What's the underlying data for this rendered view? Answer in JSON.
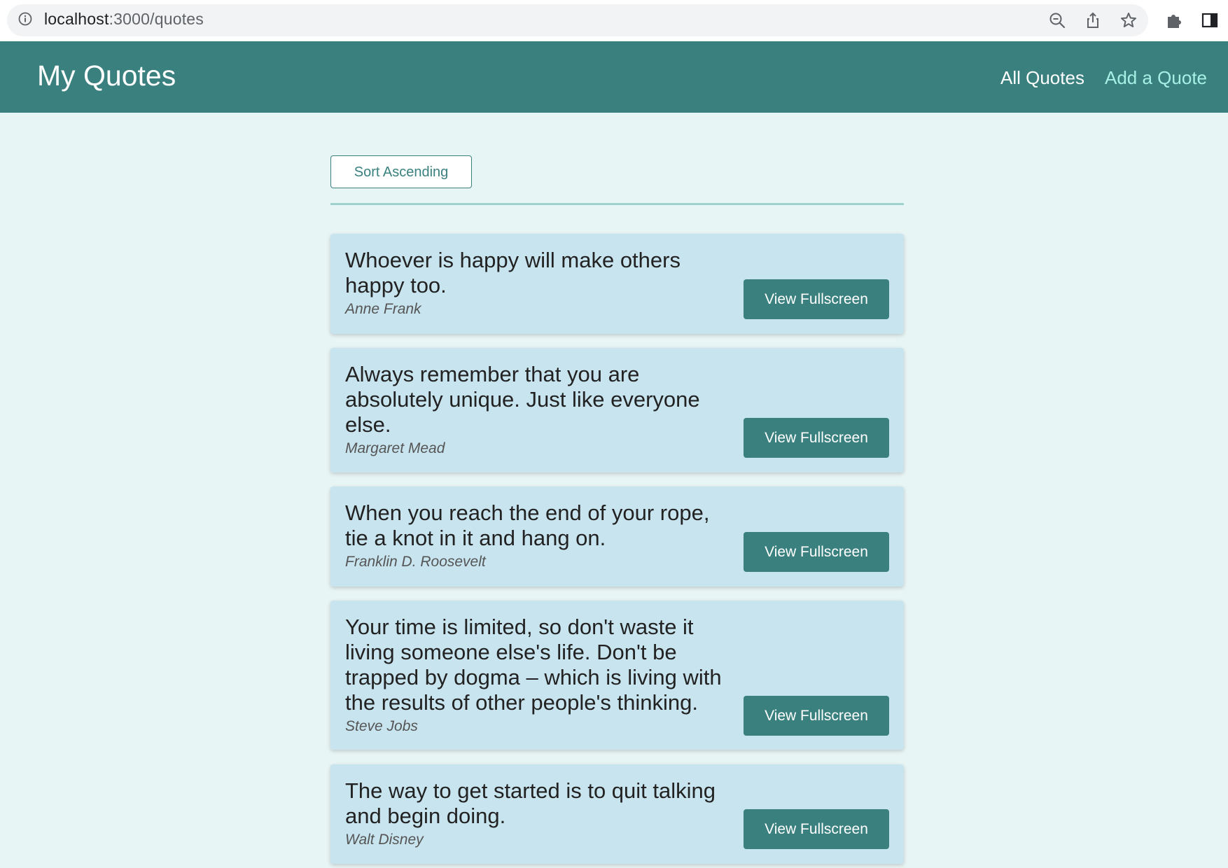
{
  "browser": {
    "url_host": "localhost",
    "url_path": ":3000/quotes",
    "icons": [
      "info-icon",
      "zoom-out-icon",
      "share-icon",
      "bookmark-star-icon",
      "extensions-puzzle-icon",
      "side-panel-icon"
    ]
  },
  "header": {
    "brand": "My Quotes",
    "nav": {
      "all_quotes": "All Quotes",
      "add_quote": "Add a Quote"
    }
  },
  "toolbar": {
    "sort_label": "Sort Ascending"
  },
  "quotes": [
    {
      "text": "Whoever is happy will make others happy too.",
      "author": "Anne Frank",
      "button": "View Fullscreen"
    },
    {
      "text": "Always remember that you are absolutely unique. Just like everyone else.",
      "author": "Margaret Mead",
      "button": "View Fullscreen"
    },
    {
      "text": "When you reach the end of your rope, tie a knot in it and hang on.",
      "author": "Franklin D. Roosevelt",
      "button": "View Fullscreen"
    },
    {
      "text": "Your time is limited, so don't waste it living someone else's life. Don't be trapped by dogma – which is living with the results of other people's thinking.",
      "author": "Steve Jobs",
      "button": "View Fullscreen"
    },
    {
      "text": "The way to get started is to quit talking and begin doing.",
      "author": "Walt Disney",
      "button": "View Fullscreen"
    }
  ],
  "colors": {
    "navbar": "#39807e",
    "nav_link_active": "#a6f0e6",
    "page_background": "#e8f5f5",
    "card_background": "#c8e4ef",
    "button": "#39807e"
  }
}
